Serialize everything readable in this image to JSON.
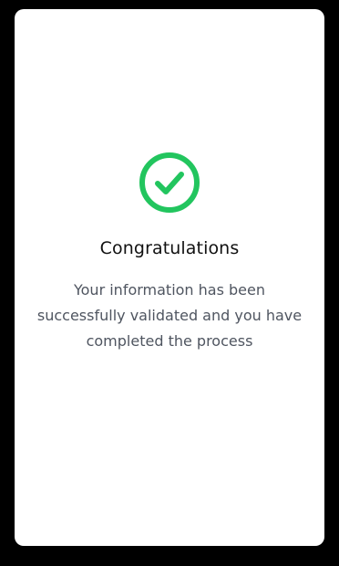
{
  "dialog": {
    "title": "Congratulations",
    "message": "Your information has been successfully validated and you have completed the process",
    "icon": "check-circle-icon"
  },
  "colors": {
    "background": "#000000",
    "card": "#ffffff",
    "success": "#22c55e",
    "title": "#111111",
    "message": "#4f5560"
  }
}
